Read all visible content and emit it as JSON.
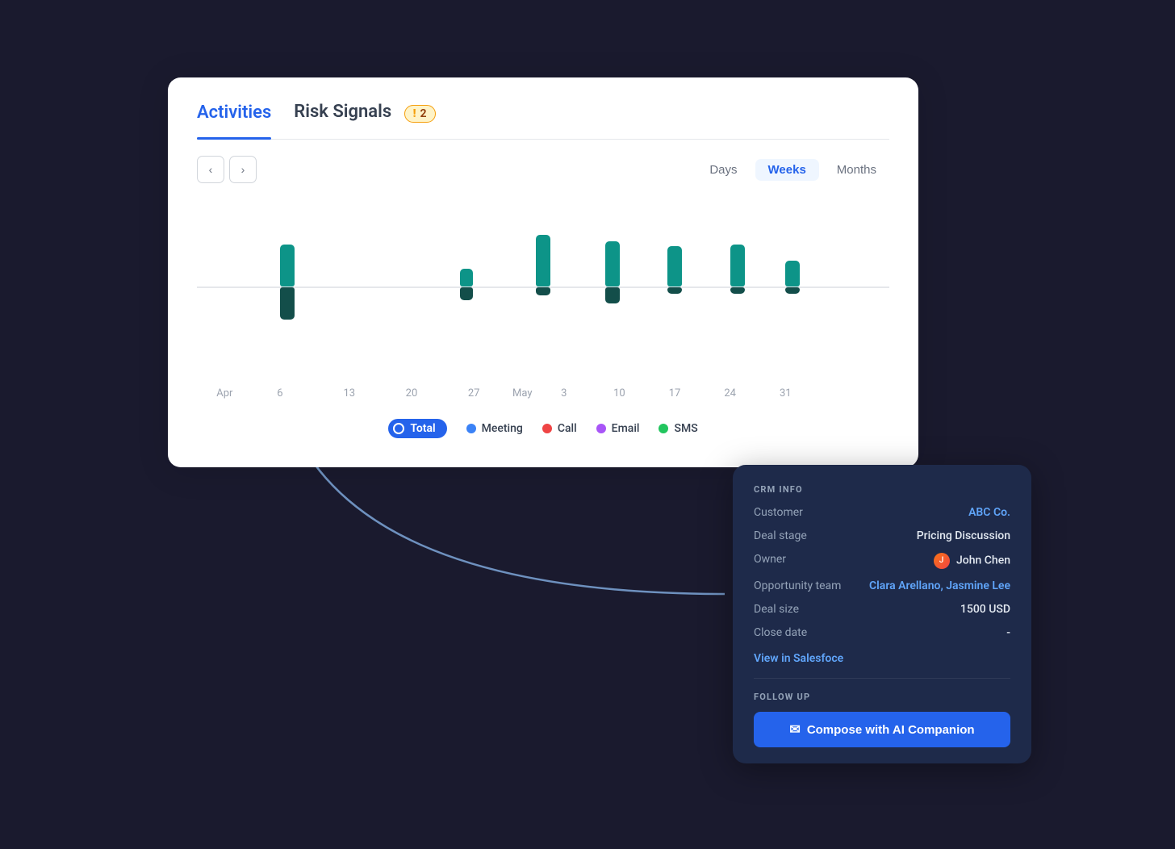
{
  "tabs": [
    {
      "id": "activities",
      "label": "Activities",
      "active": true
    },
    {
      "id": "risk-signals",
      "label": "Risk Signals",
      "active": false
    }
  ],
  "risk_badge": {
    "icon": "!",
    "count": "2"
  },
  "nav": {
    "prev_label": "‹",
    "next_label": "›"
  },
  "view_toggle": {
    "options": [
      "Days",
      "Weeks",
      "Months"
    ],
    "active": "Weeks"
  },
  "chart": {
    "x_labels": [
      {
        "text": "Apr",
        "pos": 5
      },
      {
        "text": "6",
        "pos": 12
      },
      {
        "text": "13",
        "pos": 20
      },
      {
        "text": "20",
        "pos": 28
      },
      {
        "text": "27",
        "pos": 39
      },
      {
        "text": "May",
        "pos": 46
      },
      {
        "text": "3",
        "pos": 52
      },
      {
        "text": "10",
        "pos": 60
      },
      {
        "text": "17",
        "pos": 68
      },
      {
        "text": "24",
        "pos": 76
      },
      {
        "text": "31",
        "pos": 84
      }
    ],
    "bars": [
      {
        "pos": 13,
        "top_h": 50,
        "bot_h": 38
      },
      {
        "pos": 40,
        "top_h": 20,
        "bot_h": 16
      },
      {
        "pos": 49,
        "top_h": 60,
        "bot_h": 10
      },
      {
        "pos": 59,
        "top_h": 55,
        "bot_h": 20
      },
      {
        "pos": 67,
        "top_h": 48,
        "bot_h": 10
      },
      {
        "pos": 75,
        "top_h": 50,
        "bot_h": 10
      },
      {
        "pos": 83,
        "top_h": 30,
        "bot_h": 10
      }
    ]
  },
  "legend": {
    "total_label": "Total",
    "items": [
      {
        "id": "meeting",
        "label": "Meeting",
        "color": "#3b82f6"
      },
      {
        "id": "call",
        "label": "Call",
        "color": "#ef4444"
      },
      {
        "id": "email",
        "label": "Email",
        "color": "#a855f7"
      },
      {
        "id": "sms",
        "label": "SMS",
        "color": "#22c55e"
      }
    ]
  },
  "crm": {
    "section_label": "CRM INFO",
    "rows": [
      {
        "label": "Customer",
        "value": "ABC Co.",
        "type": "link"
      },
      {
        "label": "Deal stage",
        "value": "Pricing Discussion",
        "type": "text"
      },
      {
        "label": "Owner",
        "value": "John Chen",
        "type": "owner"
      },
      {
        "label": "Opportunity team",
        "value": "Clara Arellano, Jasmine Lee",
        "type": "link"
      },
      {
        "label": "Deal size",
        "value": "1500 USD",
        "type": "text"
      },
      {
        "label": "Close date",
        "value": "-",
        "type": "text"
      }
    ],
    "salesforce_link": "View in Salesfoce",
    "follow_up_label": "FOLLOW UP",
    "compose_btn": "Compose with AI Companion"
  }
}
